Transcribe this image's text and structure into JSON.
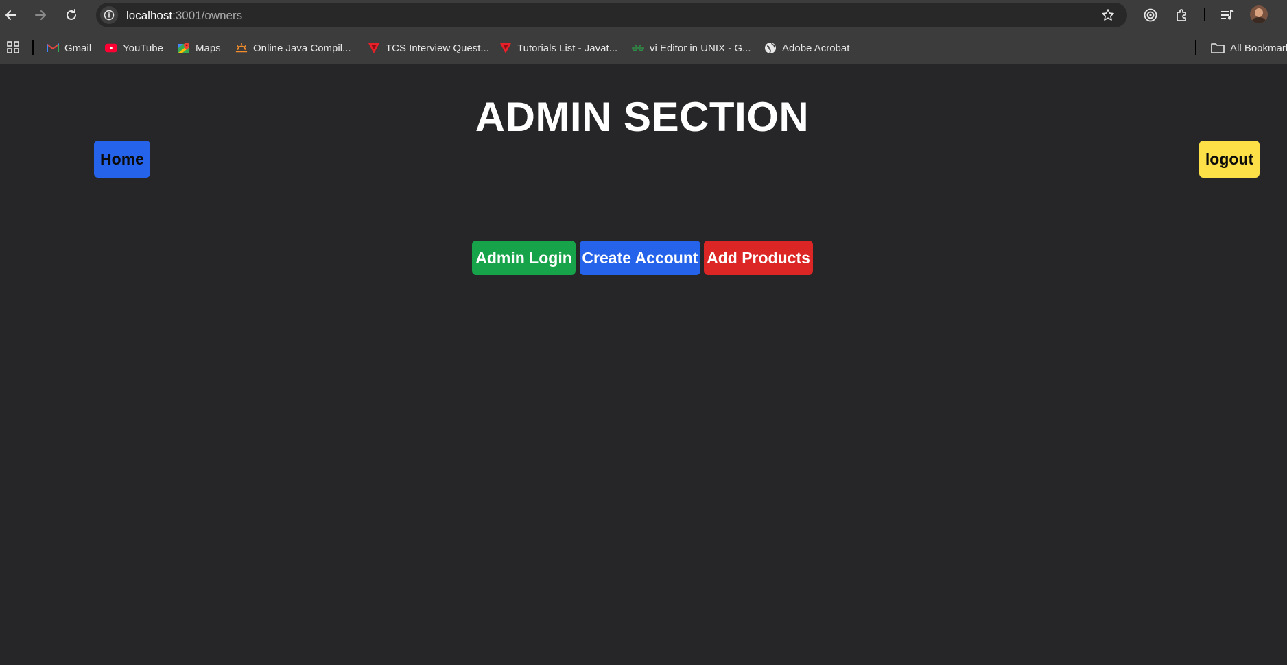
{
  "browser": {
    "url_host": "localhost",
    "url_path": ":3001/owners",
    "bookmarks": [
      {
        "label": "Gmail",
        "icon": "gmail-icon"
      },
      {
        "label": "YouTube",
        "icon": "youtube-icon"
      },
      {
        "label": "Maps",
        "icon": "maps-icon"
      },
      {
        "label": "Online Java Compil...",
        "icon": "sun-icon"
      },
      {
        "label": "TCS Interview Quest...",
        "icon": "javatpoint-icon"
      },
      {
        "label": "Tutorials List - Javat...",
        "icon": "javatpoint-icon"
      },
      {
        "label": "vi Editor in UNIX - G...",
        "icon": "geeksforgeeks-icon"
      },
      {
        "label": "Adobe Acrobat",
        "icon": "globe-icon"
      }
    ],
    "all_bookmarks_label": "All Bookmarks"
  },
  "page": {
    "title": "ADMIN SECTION",
    "home_label": "Home",
    "logout_label": "logout",
    "actions": {
      "admin_login": "Admin Login",
      "create_account": "Create Account",
      "add_products": "Add Products"
    }
  },
  "colors": {
    "background": "#262628",
    "home": "#2563eb",
    "logout": "#fde047",
    "admin_login": "#16a34a",
    "create_account": "#2563eb",
    "add_products": "#dc2626"
  }
}
